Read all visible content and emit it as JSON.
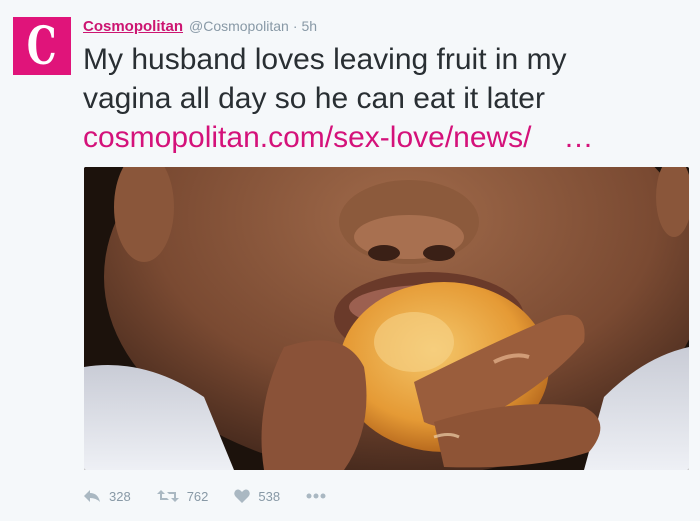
{
  "account": {
    "avatar_letter": "C",
    "display_name": "Cosmopolitan",
    "handle": "@Cosmopolitan",
    "separator": "·",
    "time": "5h"
  },
  "tweet": {
    "text_line_1": "My husband loves leaving fruit in my",
    "text_line_2": "vagina all day so he can eat it later",
    "link": "cosmopolitan.com/sex-love/news/",
    "ellipsis": "…"
  },
  "actions": {
    "reply_count": "328",
    "retweet_count": "762",
    "like_count": "538"
  },
  "icons": {
    "reply": "reply-icon",
    "retweet": "retweet-icon",
    "like": "heart-icon",
    "more": "more-icon"
  },
  "colors": {
    "brand": "#e0147a",
    "link": "#d4127a",
    "muted": "#8899a6",
    "text": "#292f33"
  }
}
